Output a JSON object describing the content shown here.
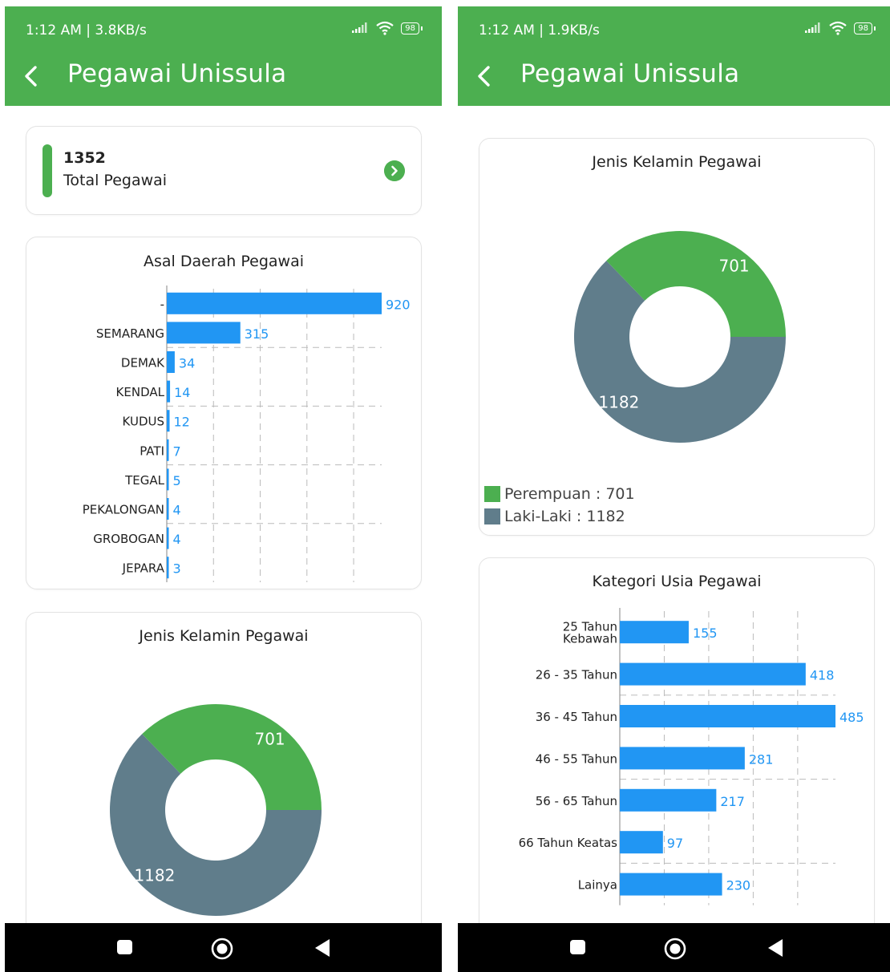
{
  "screens": [
    {
      "status": {
        "time": "1:12 AM | 3.8KB/s",
        "battery": "98"
      },
      "app_title": "Pegawai Unissula",
      "total": {
        "value": "1352",
        "label": "Total Pegawai"
      }
    },
    {
      "status": {
        "time": "1:12 AM | 1.9KB/s",
        "battery": "98"
      },
      "app_title": "Pegawai Unissula"
    }
  ],
  "colors": {
    "primary": "#4caf50",
    "bar": "#2196f3",
    "male": "#607d8b",
    "female": "#4caf50"
  },
  "chart_data": [
    {
      "type": "bar",
      "orientation": "horizontal",
      "title": "Asal Daerah Pegawai",
      "categories": [
        "-",
        "SEMARANG",
        "DEMAK",
        "KENDAL",
        "KUDUS",
        "PATI",
        "TEGAL",
        "PEKALONGAN",
        "GROBOGAN",
        "JEPARA"
      ],
      "values": [
        920,
        315,
        34,
        14,
        12,
        7,
        5,
        4,
        4,
        3
      ],
      "grid": true
    },
    {
      "type": "pie",
      "donut": true,
      "title": "Jenis Kelamin Pegawai",
      "slices": [
        {
          "label": "Laki-Laki",
          "value": 1182,
          "color": "#607d8b"
        },
        {
          "label": "Perempuan",
          "value": 701,
          "color": "#4caf50"
        }
      ],
      "legend": [
        "Perempuan : 701",
        "Laki-Laki : 1182"
      ]
    },
    {
      "type": "bar",
      "orientation": "horizontal",
      "title": "Kategori Usia Pegawai",
      "categories": [
        "25 Tahun\nKebawah",
        "26 - 35 Tahun",
        "36 - 45 Tahun",
        "46 - 55 Tahun",
        "56 - 65 Tahun",
        "66 Tahun Keatas",
        "Lainya"
      ],
      "values": [
        155,
        418,
        485,
        281,
        217,
        97,
        230
      ],
      "grid": true
    }
  ]
}
